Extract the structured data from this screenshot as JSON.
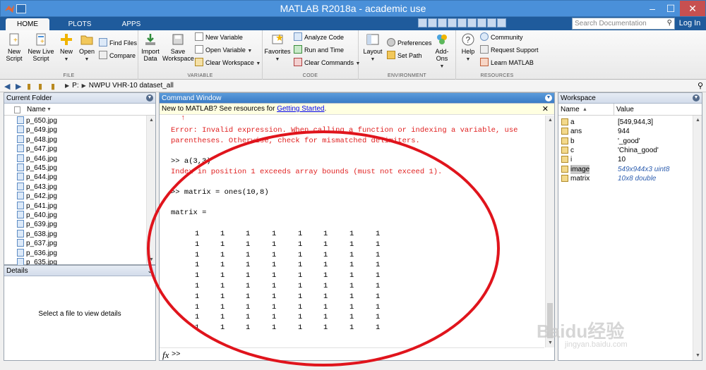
{
  "window": {
    "title": "MATLAB R2018a - academic use"
  },
  "tabs": [
    {
      "label": "HOME",
      "active": true
    },
    {
      "label": "PLOTS",
      "active": false
    },
    {
      "label": "APPS",
      "active": false
    }
  ],
  "search": {
    "placeholder": "Search Documentation",
    "login_label": "Log In"
  },
  "ribbon": {
    "file": {
      "label": "FILE",
      "new_script": "New Script",
      "new_live_script": "New Live Script",
      "new": "New",
      "open": "Open",
      "find_files": "Find Files",
      "compare": "Compare"
    },
    "variable": {
      "label": "VARIABLE",
      "import_data": "Import Data",
      "save_workspace": "Save Workspace",
      "new_variable": "New Variable",
      "open_variable": "Open Variable",
      "clear_workspace": "Clear Workspace"
    },
    "code": {
      "label": "CODE",
      "favorites": "Favorites",
      "analyze_code": "Analyze Code",
      "run_and_time": "Run and Time",
      "clear_commands": "Clear Commands"
    },
    "environment": {
      "label": "ENVIRONMENT",
      "layout": "Layout",
      "preferences": "Preferences",
      "set_path": "Set Path",
      "add_ons": "Add-Ons"
    },
    "resources": {
      "label": "RESOURCES",
      "help": "Help",
      "community": "Community",
      "request_support": "Request Support",
      "learn_matlab": "Learn MATLAB"
    }
  },
  "address": {
    "drive": "P:",
    "folder": "NWPU VHR-10 dataset_all"
  },
  "current_folder": {
    "title": "Current Folder",
    "column": "Name",
    "files": [
      "p_650.jpg",
      "p_649.jpg",
      "p_648.jpg",
      "p_647.jpg",
      "p_646.jpg",
      "p_645.jpg",
      "p_644.jpg",
      "p_643.jpg",
      "p_642.jpg",
      "p_641.jpg",
      "p_640.jpg",
      "p_639.jpg",
      "p_638.jpg",
      "p_637.jpg",
      "p_636.jpg",
      "p_635.jpg"
    ]
  },
  "details": {
    "title": "Details",
    "empty_text": "Select a file to view details"
  },
  "command_window": {
    "title": "Command Window",
    "banner_text": "New to MATLAB? See resources for ",
    "banner_link": "Getting Started",
    "banner_period": ".",
    "error_arrow": "↑",
    "error_line1": "Error: Invalid expression. When calling a function or indexing a variable, use",
    "error_line2": "parentheses. Otherwise, check for mismatched delimiters.",
    "cmd1": ">> a(3,3)",
    "error2": "Index in position 1 exceeds array bounds (must not exceed 1).",
    "cmd2": ">> matrix = ones(10,8)",
    "output_label": "matrix =",
    "matrix": [
      [
        "1",
        "1",
        "1",
        "1",
        "1",
        "1",
        "1",
        "1"
      ],
      [
        "1",
        "1",
        "1",
        "1",
        "1",
        "1",
        "1",
        "1"
      ],
      [
        "1",
        "1",
        "1",
        "1",
        "1",
        "1",
        "1",
        "1"
      ],
      [
        "1",
        "1",
        "1",
        "1",
        "1",
        "1",
        "1",
        "1"
      ],
      [
        "1",
        "1",
        "1",
        "1",
        "1",
        "1",
        "1",
        "1"
      ],
      [
        "1",
        "1",
        "1",
        "1",
        "1",
        "1",
        "1",
        "1"
      ],
      [
        "1",
        "1",
        "1",
        "1",
        "1",
        "1",
        "1",
        "1"
      ],
      [
        "1",
        "1",
        "1",
        "1",
        "1",
        "1",
        "1",
        "1"
      ],
      [
        "1",
        "1",
        "1",
        "1",
        "1",
        "1",
        "1",
        "1"
      ],
      [
        "1",
        "1",
        "1",
        "1",
        "1",
        "1",
        "1",
        "1"
      ]
    ],
    "prompt": ">>",
    "fx": "fx"
  },
  "workspace": {
    "title": "Workspace",
    "col_name": "Name",
    "col_value": "Value",
    "variables": [
      {
        "name": "a",
        "value": "[549,944,3]",
        "italic": false
      },
      {
        "name": "ans",
        "value": "944",
        "italic": false
      },
      {
        "name": "b",
        "value": "'_good'",
        "italic": false
      },
      {
        "name": "c",
        "value": "'China_good'",
        "italic": false
      },
      {
        "name": "i",
        "value": "10",
        "italic": false
      },
      {
        "name": "image",
        "value": "549x944x3 uint8",
        "italic": true
      },
      {
        "name": "matrix",
        "value": "10x8 double",
        "italic": true
      }
    ]
  },
  "watermark": {
    "text": "Baidu经验",
    "sub": "jingyan.baidu.com"
  },
  "colors": {
    "titlebar": "#4a90d9",
    "tabrow": "#1f5b9c",
    "error": "#e02020",
    "annotation": "#e0141c"
  }
}
